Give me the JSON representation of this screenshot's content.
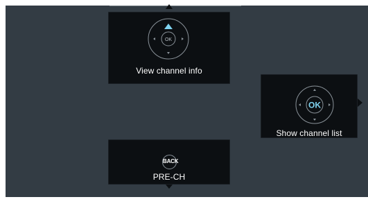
{
  "hints": {
    "view_info": {
      "label": "View channel info",
      "center_key": "OK",
      "icon": "dpad-up-highlighted-icon"
    },
    "channel_list": {
      "label": "Show channel list",
      "center_key": "OK",
      "icon": "dpad-ok-highlighted-icon"
    },
    "previous_channel": {
      "label": "PRE-CH",
      "button_key": "BACK",
      "icon": "back-button-icon"
    }
  },
  "colors": {
    "background": "#333c44",
    "card": "#0c0f12",
    "highlight": "#7fd3f0",
    "ring": "#8a9299",
    "text": "#ffffff"
  }
}
